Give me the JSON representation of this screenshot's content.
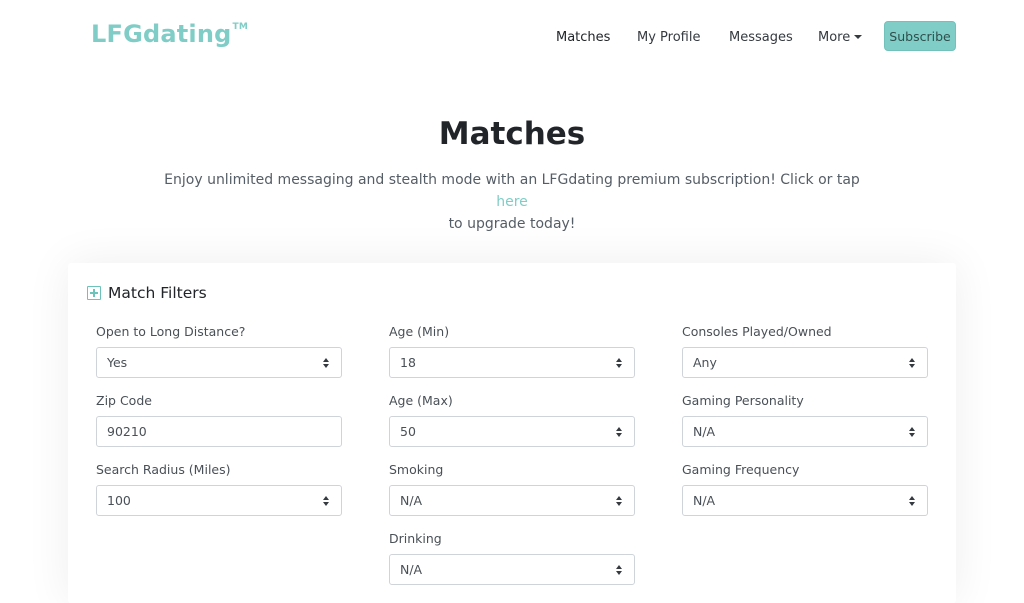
{
  "brand": {
    "name": "LFGdating",
    "tm": "TM"
  },
  "nav": {
    "items": [
      "Matches",
      "My Profile",
      "Messages",
      "More"
    ],
    "subscribe_label": "Subscribe"
  },
  "page": {
    "title": "Matches",
    "intro_text": "Enjoy unlimited messaging and stealth mode with an LFGdating premium subscription! Click or tap ",
    "intro_link": "here",
    "intro_text_2": "to upgrade today!"
  },
  "filters": {
    "title": "Match Filters",
    "fields": {
      "long_distance": {
        "label": "Open to Long Distance?",
        "value": "Yes"
      },
      "zip_code": {
        "label": "Zip Code",
        "value": "90210"
      },
      "radius": {
        "label": "Search Radius (Miles)",
        "value": "100"
      },
      "age_min": {
        "label": "Age (Min)",
        "value": "18"
      },
      "age_max": {
        "label": "Age (Max)",
        "value": "50"
      },
      "smoking": {
        "label": "Smoking",
        "value": "N/A"
      },
      "drinking": {
        "label": "Drinking",
        "value": "N/A"
      },
      "consoles": {
        "label": "Consoles Played/Owned",
        "value": "Any"
      },
      "personality": {
        "label": "Gaming Personality",
        "value": "N/A"
      },
      "frequency": {
        "label": "Gaming Frequency",
        "value": "N/A"
      }
    }
  },
  "colors": {
    "brand": "#7fcdc6",
    "text": "#212529"
  }
}
